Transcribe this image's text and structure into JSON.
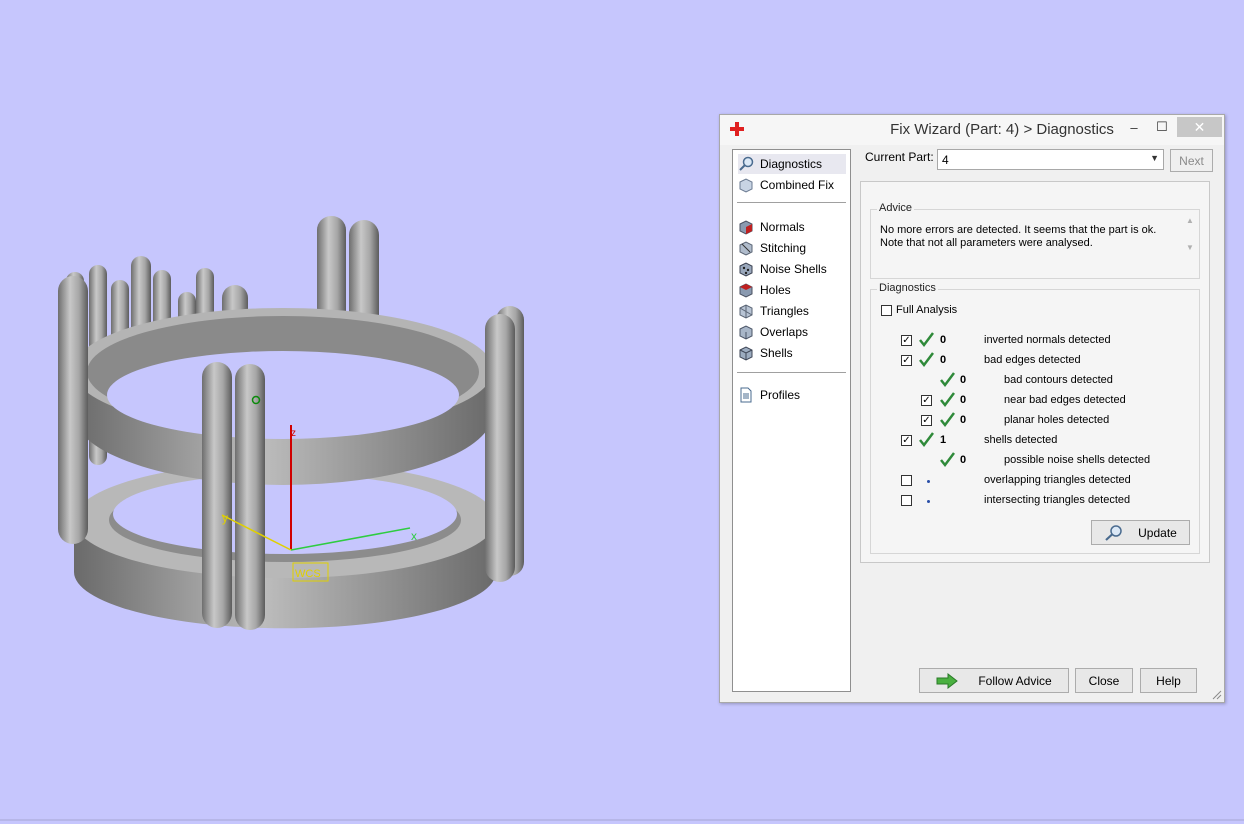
{
  "window": {
    "title": "Fix Wizard (Part: 4) > Diagnostics",
    "controls": {
      "minimize": "–",
      "maximize": "☐",
      "close": "✕"
    }
  },
  "viewport": {
    "axis_labels": {
      "x": "x",
      "y": "y",
      "z": "z"
    },
    "wcs_label": "WCS"
  },
  "nav": {
    "items": [
      {
        "label": "Diagnostics",
        "icon": "magnifier-icon",
        "selected": true
      },
      {
        "label": "Combined Fix",
        "icon": "combined-fix-icon"
      },
      {
        "label": "Normals",
        "icon": "normals-icon"
      },
      {
        "label": "Stitching",
        "icon": "stitching-icon"
      },
      {
        "label": "Noise Shells",
        "icon": "noise-shells-icon"
      },
      {
        "label": "Holes",
        "icon": "holes-icon"
      },
      {
        "label": "Triangles",
        "icon": "triangles-icon"
      },
      {
        "label": "Overlaps",
        "icon": "overlaps-icon"
      },
      {
        "label": "Shells",
        "icon": "shells-icon"
      },
      {
        "label": "Profiles",
        "icon": "profiles-icon"
      }
    ]
  },
  "current_part": {
    "label": "Current Part:",
    "value": "4"
  },
  "next_button": "Next",
  "advice": {
    "title": "Advice",
    "line1": "No more errors are detected. It seems that the part is ok.",
    "line2": "Note that not all parameters were analysed."
  },
  "diagnostics": {
    "title": "Diagnostics",
    "full_analysis": {
      "label": "Full Analysis",
      "checked": false
    },
    "rows": [
      {
        "checkbox": true,
        "checked": true,
        "ok": true,
        "count": "0",
        "label": "inverted normals detected",
        "indent": 0
      },
      {
        "checkbox": true,
        "checked": true,
        "ok": true,
        "count": "0",
        "label": "bad edges detected",
        "indent": 0
      },
      {
        "checkbox": false,
        "checked": false,
        "ok": true,
        "count": "0",
        "label": "bad contours detected",
        "indent": 1
      },
      {
        "checkbox": true,
        "checked": true,
        "ok": true,
        "count": "0",
        "label": "near bad edges detected",
        "indent": 1
      },
      {
        "checkbox": true,
        "checked": true,
        "ok": true,
        "count": "0",
        "label": "planar holes detected",
        "indent": 1
      },
      {
        "checkbox": true,
        "checked": true,
        "ok": true,
        "count": "1",
        "label": "shells detected",
        "indent": 0
      },
      {
        "checkbox": false,
        "checked": false,
        "ok": true,
        "count": "0",
        "label": "possible noise shells detected",
        "indent": 1
      },
      {
        "checkbox": true,
        "checked": false,
        "ok": false,
        "count": "",
        "label": "overlapping triangles detected",
        "indent": 0
      },
      {
        "checkbox": true,
        "checked": false,
        "ok": false,
        "count": "",
        "label": "intersecting triangles detected",
        "indent": 0
      }
    ],
    "update_button": "Update"
  },
  "footer": {
    "follow_advice": "Follow Advice",
    "close": "Close",
    "help": "Help"
  },
  "colors": {
    "background": "#c6c6fd",
    "model": "#9a9a9a",
    "tick_green": "#2f8a3a",
    "axis_x": "#2ecc40",
    "axis_y": "#e0d000",
    "axis_z": "#d00000"
  }
}
